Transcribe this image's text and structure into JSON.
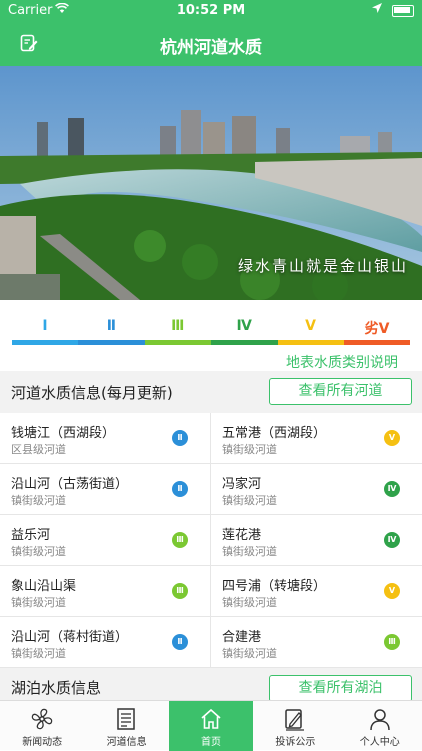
{
  "status_bar": {
    "carrier": "Carrier",
    "time": "10:52 PM"
  },
  "header": {
    "title": "杭州河道水质"
  },
  "banner": {
    "caption": "绿水青山就是金山银山"
  },
  "grades": [
    {
      "label": "Ⅰ",
      "color": "#2fa7e6"
    },
    {
      "label": "Ⅱ",
      "color": "#2b8fd8"
    },
    {
      "label": "Ⅲ",
      "color": "#7bc832"
    },
    {
      "label": "Ⅳ",
      "color": "#2fa24a"
    },
    {
      "label": "Ⅴ",
      "color": "#f5c012"
    },
    {
      "label": "劣Ⅴ",
      "color": "#ef5b26"
    }
  ],
  "legend_link": "地表水质类别说明",
  "river_section": {
    "title": "河道水质信息(每月更新)",
    "button": "查看所有河道"
  },
  "rivers": [
    {
      "name": "钱塘江（西湖段）",
      "type": "区县级河道",
      "grade": "Ⅱ",
      "color": "#2b8fd8"
    },
    {
      "name": "五常港（西湖段）",
      "type": "镇街级河道",
      "grade": "Ⅴ",
      "color": "#f5c012"
    },
    {
      "name": "沿山河（古荡街道）",
      "type": "镇街级河道",
      "grade": "Ⅱ",
      "color": "#2b8fd8"
    },
    {
      "name": "冯家河",
      "type": "镇街级河道",
      "grade": "Ⅳ",
      "color": "#2fa24a"
    },
    {
      "name": "益乐河",
      "type": "镇街级河道",
      "grade": "Ⅲ",
      "color": "#7bc832"
    },
    {
      "name": "莲花港",
      "type": "镇街级河道",
      "grade": "Ⅳ",
      "color": "#2fa24a"
    },
    {
      "name": "象山沿山渠",
      "type": "镇街级河道",
      "grade": "Ⅲ",
      "color": "#7bc832"
    },
    {
      "name": "四号浦（转塘段）",
      "type": "镇街级河道",
      "grade": "Ⅴ",
      "color": "#f5c012"
    },
    {
      "name": "沿山河（蒋村街道）",
      "type": "镇街级河道",
      "grade": "Ⅱ",
      "color": "#2b8fd8"
    },
    {
      "name": "合建港",
      "type": "镇街级河道",
      "grade": "Ⅲ",
      "color": "#7bc832"
    }
  ],
  "lake_section": {
    "title": "湖泊水质信息",
    "button": "查看所有湖泊"
  },
  "tabs": [
    {
      "label": "新闻动态",
      "icon": "fan-icon"
    },
    {
      "label": "河道信息",
      "icon": "document-icon"
    },
    {
      "label": "首页",
      "icon": "home-icon"
    },
    {
      "label": "投诉公示",
      "icon": "edit-note-icon"
    },
    {
      "label": "个人中心",
      "icon": "user-icon"
    }
  ]
}
